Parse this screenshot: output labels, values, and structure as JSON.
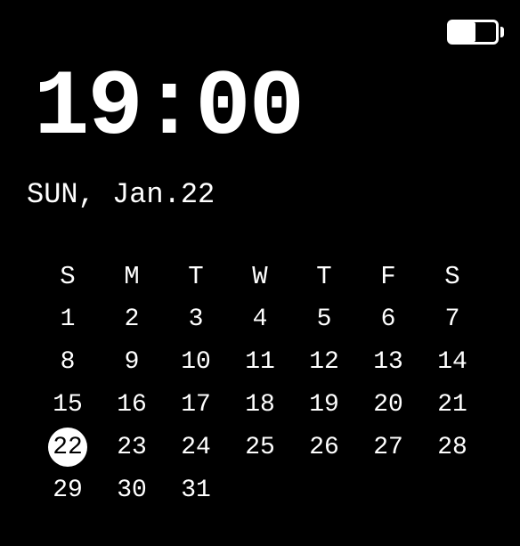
{
  "status": {
    "battery_percent": 55
  },
  "clock": {
    "time": "19:00",
    "date": "SUN, Jan.22"
  },
  "calendar": {
    "weekdays": [
      "S",
      "M",
      "T",
      "W",
      "T",
      "F",
      "S"
    ],
    "today": 22,
    "weeks": [
      [
        1,
        2,
        3,
        4,
        5,
        6,
        7
      ],
      [
        8,
        9,
        10,
        11,
        12,
        13,
        14
      ],
      [
        15,
        16,
        17,
        18,
        19,
        20,
        21
      ],
      [
        22,
        23,
        24,
        25,
        26,
        27,
        28
      ],
      [
        29,
        30,
        31,
        null,
        null,
        null,
        null
      ]
    ]
  }
}
